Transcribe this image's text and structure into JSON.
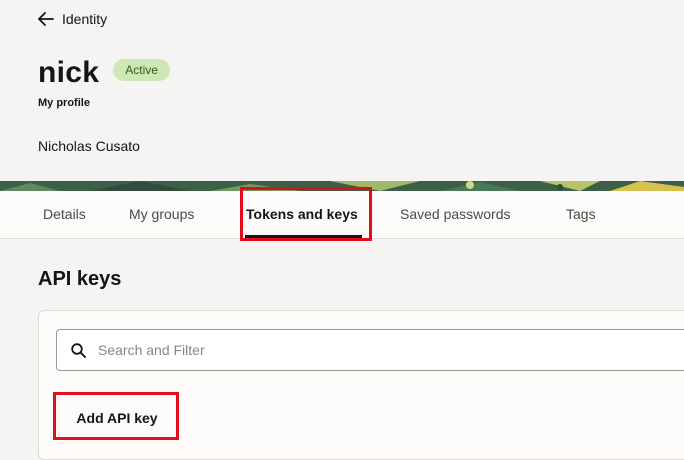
{
  "header": {
    "back_label": "Identity",
    "title": "nick",
    "status_badge": "Active",
    "subtitle": "My profile",
    "username": "Nicholas Cusato"
  },
  "tabs": [
    {
      "label": "Details",
      "active": false
    },
    {
      "label": "My groups",
      "active": false
    },
    {
      "label": "Tokens and keys",
      "active": true
    },
    {
      "label": "Saved passwords",
      "active": false
    },
    {
      "label": "Tags",
      "active": false
    }
  ],
  "section": {
    "title": "API keys",
    "search_placeholder": "Search and Filter",
    "add_button_label": "Add API key"
  },
  "icons": {
    "back": "arrow-left-icon",
    "search": "search-icon"
  },
  "colors": {
    "badge_bg": "#cfe7b7",
    "badge_text": "#2e5c12",
    "highlight": "#e10d1c",
    "page_bg": "#f5f4f2"
  }
}
